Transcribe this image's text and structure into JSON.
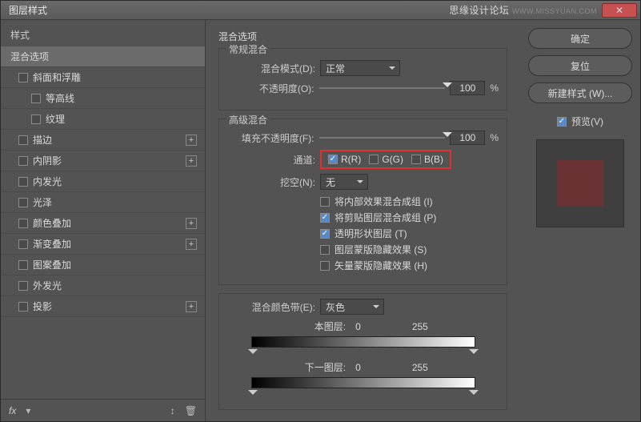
{
  "window": {
    "title": "图层样式"
  },
  "watermark": {
    "text": "思缘设计论坛",
    "url": "WWW.MISSYUAN.COM"
  },
  "left": {
    "header": "样式",
    "items": [
      {
        "label": "混合选项",
        "selected": true,
        "hasCheck": false,
        "hasPlus": false
      },
      {
        "label": "斜面和浮雕",
        "selected": false,
        "hasCheck": true,
        "checked": false,
        "hasPlus": false
      },
      {
        "label": "等高线",
        "selected": false,
        "hasCheck": true,
        "checked": false,
        "hasPlus": false,
        "indent": true
      },
      {
        "label": "纹理",
        "selected": false,
        "hasCheck": true,
        "checked": false,
        "hasPlus": false,
        "indent": true
      },
      {
        "label": "描边",
        "selected": false,
        "hasCheck": true,
        "checked": false,
        "hasPlus": true
      },
      {
        "label": "内阴影",
        "selected": false,
        "hasCheck": true,
        "checked": false,
        "hasPlus": true
      },
      {
        "label": "内发光",
        "selected": false,
        "hasCheck": true,
        "checked": false,
        "hasPlus": false
      },
      {
        "label": "光泽",
        "selected": false,
        "hasCheck": true,
        "checked": false,
        "hasPlus": false
      },
      {
        "label": "颜色叠加",
        "selected": false,
        "hasCheck": true,
        "checked": false,
        "hasPlus": true
      },
      {
        "label": "渐变叠加",
        "selected": false,
        "hasCheck": true,
        "checked": false,
        "hasPlus": true
      },
      {
        "label": "图案叠加",
        "selected": false,
        "hasCheck": true,
        "checked": false,
        "hasPlus": false
      },
      {
        "label": "外发光",
        "selected": false,
        "hasCheck": true,
        "checked": false,
        "hasPlus": false
      },
      {
        "label": "投影",
        "selected": false,
        "hasCheck": true,
        "checked": false,
        "hasPlus": true
      }
    ],
    "footer_fx": "fx"
  },
  "mid": {
    "section": "混合选项",
    "general": {
      "title": "常规混合",
      "blend_label": "混合模式(D):",
      "blend_value": "正常",
      "opacity_label": "不透明度(O):",
      "opacity_value": "100",
      "pct": "%"
    },
    "advanced": {
      "title": "高级混合",
      "fill_label": "填充不透明度(F):",
      "fill_value": "100",
      "pct": "%",
      "channels_label": "通道:",
      "ch_r": "R(R)",
      "ch_g": "G(G)",
      "ch_b": "B(B)",
      "knockout_label": "挖空(N):",
      "knockout_value": "无",
      "opts": [
        {
          "label": "将内部效果混合成组 (I)",
          "checked": false
        },
        {
          "label": "将剪贴图层混合成组 (P)",
          "checked": true
        },
        {
          "label": "透明形状图层 (T)",
          "checked": true
        },
        {
          "label": "图层蒙版隐藏效果 (S)",
          "checked": false
        },
        {
          "label": "矢量蒙版隐藏效果 (H)",
          "checked": false
        }
      ]
    },
    "blendif": {
      "title_label": "混合颜色带(E):",
      "title_value": "灰色",
      "this_label": "本图层:",
      "this_lo": "0",
      "this_hi": "255",
      "under_label": "下一图层:",
      "under_lo": "0",
      "under_hi": "255"
    }
  },
  "right": {
    "ok": "确定",
    "cancel": "复位",
    "newstyle": "新建样式 (W)...",
    "preview_label": "预览(V)"
  }
}
